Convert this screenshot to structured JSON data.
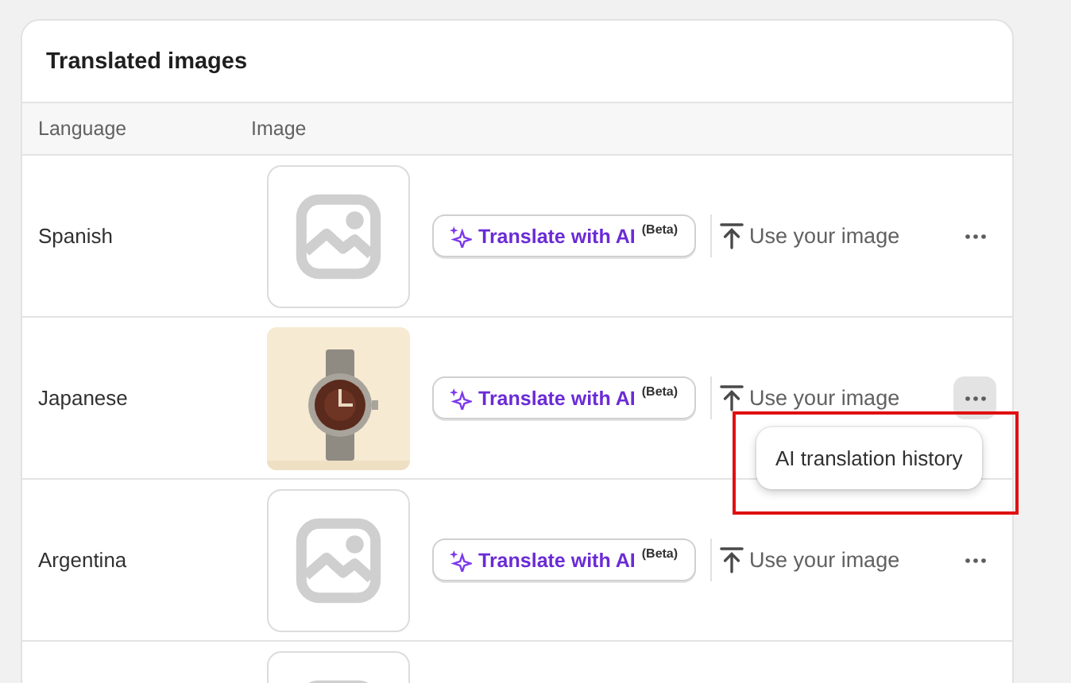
{
  "card": {
    "title": "Translated images"
  },
  "table": {
    "columns": [
      "Language",
      "Image"
    ],
    "rows": [
      {
        "language": "Spanish",
        "image": {
          "kind": "placeholder"
        },
        "translate_button": {
          "label": "Translate with AI",
          "badge": "(Beta)"
        },
        "upload_link": "Use your image",
        "more_button": {
          "selected": false
        }
      },
      {
        "language": "Japanese",
        "translate_button": {
          "label": "Translate with AI",
          "badge": "(Beta)"
        },
        "upload_link": "Use your image",
        "more_button": {
          "selected": true
        },
        "menu": {
          "items": [
            "AI translation history"
          ],
          "highlighted": true
        }
      },
      {
        "language": "Argentina",
        "image": {
          "kind": "placeholder"
        },
        "translate_button": {
          "label": "Translate with AI",
          "badge": "(Beta)"
        },
        "upload_link": "Use your image",
        "more_button": {
          "selected": false
        }
      },
      {
        "image": {
          "kind": "placeholder"
        }
      }
    ]
  }
}
